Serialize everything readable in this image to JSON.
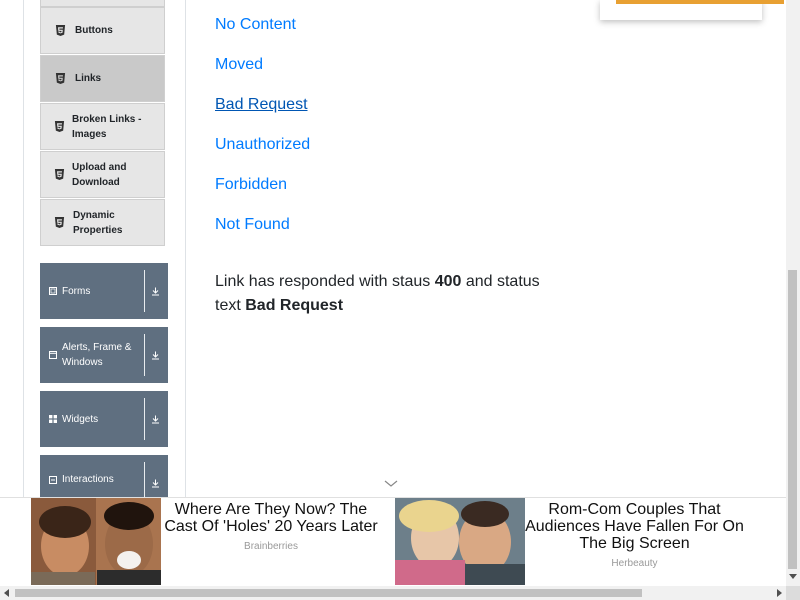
{
  "sidebar": {
    "sub_items": [
      {
        "label": "Buttons",
        "icon": "html5-icon",
        "active": false
      },
      {
        "label": "Links",
        "icon": "html5-icon",
        "active": true
      },
      {
        "label": "Broken Links - Images",
        "icon": "html5-icon",
        "active": false
      },
      {
        "label": "Upload and Download",
        "icon": "html5-icon",
        "active": false
      },
      {
        "label": "Dynamic Properties",
        "icon": "html5-icon",
        "active": false
      }
    ],
    "groups": [
      {
        "label": "Forms",
        "icon": "form-icon"
      },
      {
        "label": "Alerts, Frame & Windows",
        "icon": "window-icon"
      },
      {
        "label": "Widgets",
        "icon": "widgets-grid-icon"
      },
      {
        "label": "Interactions",
        "icon": "interactions-icon"
      }
    ]
  },
  "links": [
    {
      "label": "No Content"
    },
    {
      "label": "Moved"
    },
    {
      "label": "Bad Request"
    },
    {
      "label": "Unauthorized"
    },
    {
      "label": "Forbidden"
    },
    {
      "label": "Not Found"
    }
  ],
  "response": {
    "prefix": "Link has responded with staus ",
    "status_code": "400",
    "middle": " and status text ",
    "status_text": "Bad Request"
  },
  "ads": [
    {
      "title": "Where Are They Now? The Cast Of 'Holes' 20 Years Later",
      "source": "Brainberries"
    },
    {
      "title": "Rom-Com Couples That Audiences Have Fallen For On The Big Screen",
      "source": "Herbeauty"
    }
  ],
  "colors": {
    "link": "#007bff",
    "group_bg": "#5f6f80",
    "active_item_bg": "#c9c9c9",
    "ad_accent": "#e8a032"
  }
}
